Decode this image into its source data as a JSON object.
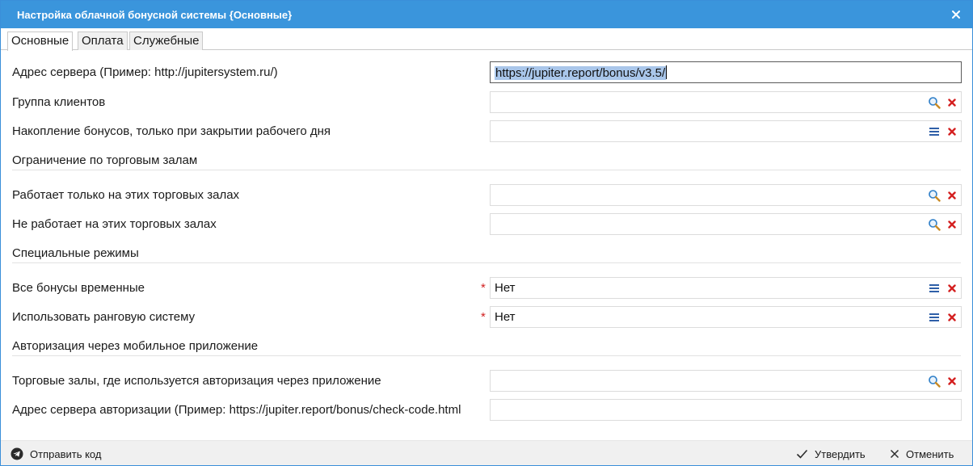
{
  "window": {
    "title": "Настройка облачной бонусной системы {Основные}"
  },
  "tabs": [
    {
      "label": "Основные",
      "active": true
    },
    {
      "label": "Оплата",
      "active": false
    },
    {
      "label": "Служебные",
      "active": false
    }
  ],
  "fields": {
    "server_address": {
      "label": "Адрес сервера (Пример: http://jupitersystem.ru/)",
      "value": "https://jupiter.report/bonus/v3.5/"
    },
    "client_group": {
      "label": "Группа клиентов",
      "value": ""
    },
    "bonus_accumulation": {
      "label": "Накопление бонусов, только при закрытии рабочего дня",
      "value": ""
    },
    "works_only_halls": {
      "label": "Работает только на этих торговых залах",
      "value": ""
    },
    "not_works_halls": {
      "label": "Не работает на этих торговых залах",
      "value": ""
    },
    "all_bonuses_temporary": {
      "label": "Все бонусы временные",
      "required": "*",
      "value": "Нет"
    },
    "use_rank_system": {
      "label": "Использовать ранговую систему",
      "required": "*",
      "value": "Нет"
    },
    "auth_halls": {
      "label": "Торговые залы, где используется авторизация через приложение",
      "value": ""
    },
    "auth_server": {
      "label": "Адрес сервера авторизации (Пример: https://jupiter.report/bonus/check-code.html",
      "value": ""
    }
  },
  "sections": {
    "halls_restriction": "Ограничение по торговым залам",
    "special_modes": "Специальные режимы",
    "mobile_auth": "Авторизация через мобильное приложение"
  },
  "footer": {
    "send_code": "Отправить код",
    "confirm": "Утвердить",
    "cancel": "Отменить"
  },
  "colors": {
    "titlebar": "#3a95dc",
    "accent_blue": "#2f7fc8",
    "clear_red": "#d42020",
    "selection": "#a9c6ea"
  },
  "icons": {
    "search": "search-icon",
    "menu": "list-icon",
    "clear": "clear-icon",
    "close": "close-icon",
    "telegram": "telegram-icon",
    "check": "check-icon",
    "cancel": "cancel-x-icon"
  }
}
